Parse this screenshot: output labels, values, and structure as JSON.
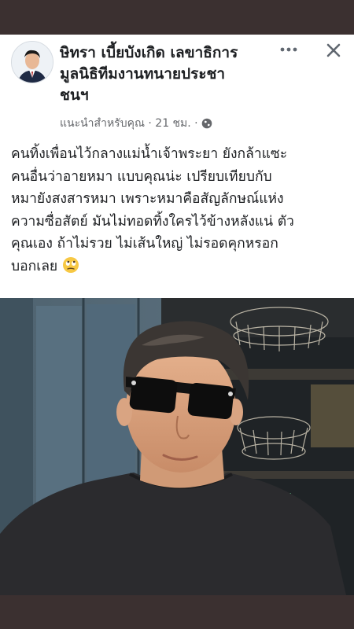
{
  "post": {
    "author_line1": "ษิทรา เบี้ยบังเกิด เลขาธิการ",
    "author_line2": "มูลนิธิทีมงานทนายประชา",
    "author_line3": "ชนฯ",
    "meta_text": "แนะนำสำหรับคุณ · 21 ชม. ·",
    "lines": [
      "คนทิ้งเพื่อนไว้กลางแม่น้ำเจ้าพระยา ยังกล้าแซะ",
      "คนอื่นว่าอายหมา แบบคุณน่ะ เปรียบเทียบกับ",
      "หมายังสงสารหมา เพราะหมาคือสัญลักษณ์แห่ง",
      "ความซื่อสัตย์ มันไม่ทอดทิ้งใครไว้ข้างหลังแน่ ตัว",
      "คุณเอง ถ้าไม่รวย ไม่เส้นใหญ่ ไม่รอดคุกหรอก"
    ],
    "last_line": "บอกเลย",
    "emoji": "rolling-eyes-emoji"
  },
  "icons": {
    "more": "more-options-icon",
    "close": "close-icon",
    "audience": "globe-icon"
  },
  "colors": {
    "author_text": "#1c1e21",
    "meta_text": "#65676b",
    "frame": "#3b3030"
  }
}
